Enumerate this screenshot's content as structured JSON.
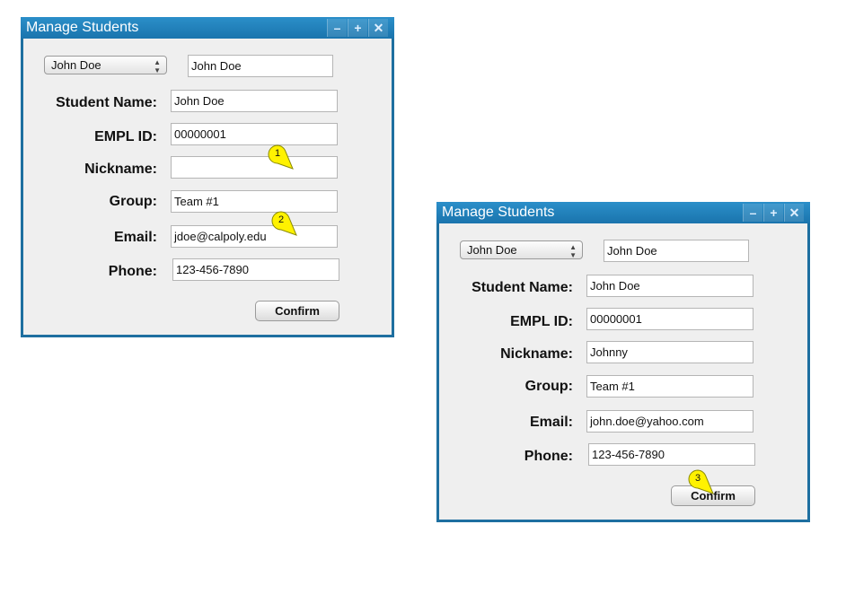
{
  "windows": [
    {
      "title": "Manage Students",
      "select_value": "John Doe",
      "select_echo": "John Doe",
      "labels": {
        "name": "Student Name:",
        "empl": "EMPL ID:",
        "nick": "Nickname:",
        "group": "Group:",
        "email": "Email:",
        "phone": "Phone:"
      },
      "values": {
        "name": "John Doe",
        "empl": "00000001",
        "nick": "",
        "group": "Team #1",
        "email": "jdoe@calpoly.edu",
        "phone": "123-456-7890"
      },
      "confirm": "Confirm",
      "callouts": [
        "1",
        "2"
      ]
    },
    {
      "title": "Manage Students",
      "select_value": "John Doe",
      "select_echo": "John Doe",
      "labels": {
        "name": "Student Name:",
        "empl": "EMPL ID:",
        "nick": "Nickname:",
        "group": "Group:",
        "email": "Email:",
        "phone": "Phone:"
      },
      "values": {
        "name": "John Doe",
        "empl": "00000001",
        "nick": "Johnny",
        "group": "Team #1",
        "email": "john.doe@yahoo.com",
        "phone": "123-456-7890"
      },
      "confirm": "Confirm",
      "callouts": [
        "3"
      ]
    }
  ],
  "titlebar_buttons": {
    "minimize": "–",
    "maximize": "+",
    "close": "✕"
  },
  "colors": {
    "frame": "#1e6fa0",
    "titlebar": "#2b8fc9",
    "callout": "#fff200"
  }
}
